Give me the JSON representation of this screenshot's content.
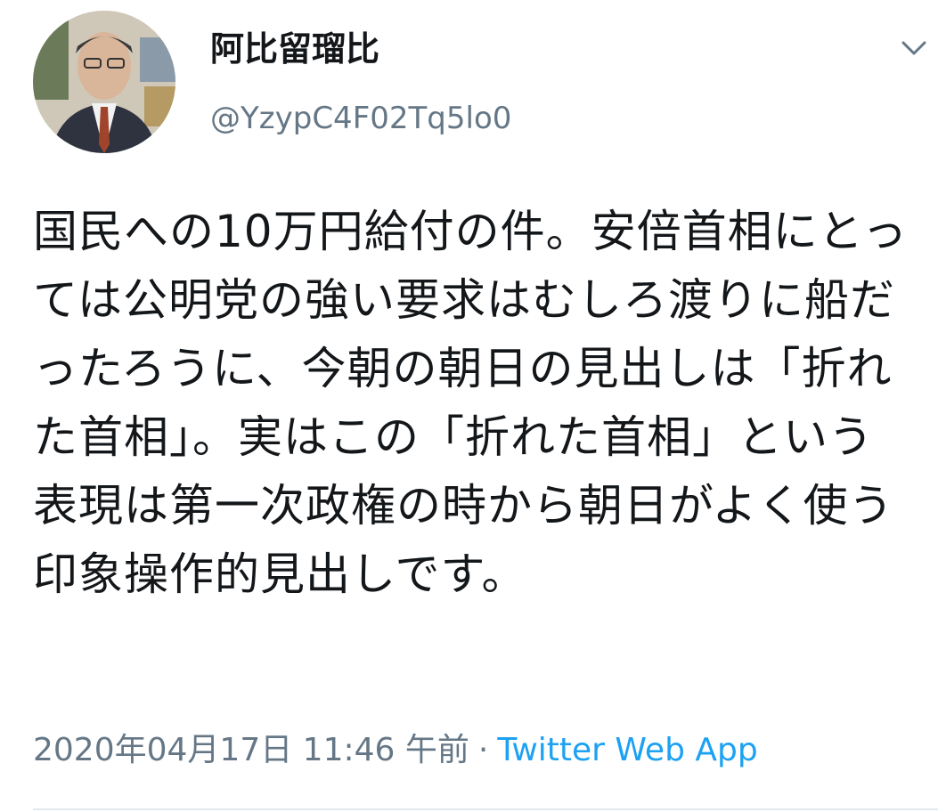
{
  "tweet": {
    "author": {
      "display_name": "阿比留瑠比",
      "handle": "@YzypC4F02Tq5lo0",
      "avatar_icon": "user-avatar-photo"
    },
    "menu_icon": "chevron-down-icon",
    "text": "国民への10万円給付の件。安倍首相にとっては公明党の強い要求はむしろ渡りに船だったろうに、今朝の朝日の見出しは「折れた首相」。実はこの「折れた首相」という表現は第一次政権の時から朝日がよく使う印象操作的見出しです。",
    "timestamp": "2020年04月17日 11:46 午前",
    "separator": "·",
    "source": "Twitter Web App"
  },
  "colors": {
    "text": "#14171a",
    "secondary": "#657786",
    "link": "#1da1f2",
    "divider": "#e1e8ed"
  }
}
